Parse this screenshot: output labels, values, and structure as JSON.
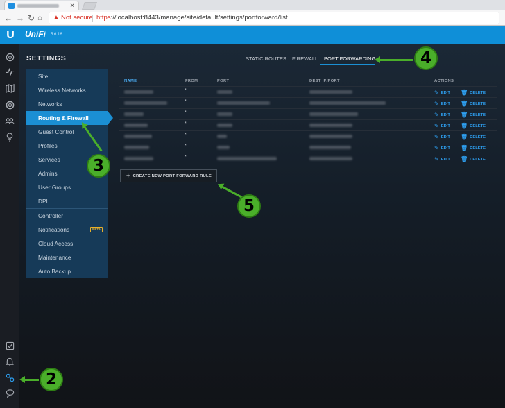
{
  "browser": {
    "address": {
      "security_label": "Not secure",
      "url_scheme": "https",
      "url_rest": "://localhost:8443/manage/site/default/settings/portforward/list"
    }
  },
  "app": {
    "logo_letter": "U",
    "brand": "UniFi",
    "version": "5.6.16"
  },
  "rail_icons": [
    "dashboard-icon",
    "statistics-icon",
    "map-icon",
    "devices-icon",
    "clients-icon",
    "insights-icon",
    "events-icon",
    "alerts-icon",
    "settings-icon",
    "support-chat-icon"
  ],
  "settings": {
    "title": "SETTINGS",
    "menu_group1": [
      "Site",
      "Wireless Networks",
      "Networks",
      "Routing & Firewall",
      "Guest Control",
      "Profiles",
      "Services",
      "Admins",
      "User Groups",
      "DPI"
    ],
    "menu_group2": [
      "Controller",
      "Notifications",
      "Cloud Access",
      "Maintenance",
      "Auto Backup"
    ],
    "active_item": "Routing & Firewall",
    "beta_label": "BETA"
  },
  "tabs": [
    {
      "label": "STATIC ROUTES",
      "active": false
    },
    {
      "label": "FIREWALL",
      "active": false
    },
    {
      "label": "PORT FORWARDING",
      "active": true
    }
  ],
  "table": {
    "headers": {
      "name": "NAME",
      "sort_arrow": "↑",
      "from": "FROM",
      "port": "PORT",
      "dest": "DEST IP/PORT",
      "actions": "ACTIONS"
    },
    "from_value": "*",
    "edit_label": "EDIT",
    "delete_label": "DELETE",
    "row_count": 7
  },
  "create_button": {
    "plus": "+",
    "label": "CREATE NEW PORT FORWARD RULE"
  },
  "callouts": [
    "2",
    "3",
    "4",
    "5"
  ],
  "colors": {
    "accent": "#1b8fd4",
    "callout": "#4aae2a",
    "header": "#0f8fd8"
  }
}
